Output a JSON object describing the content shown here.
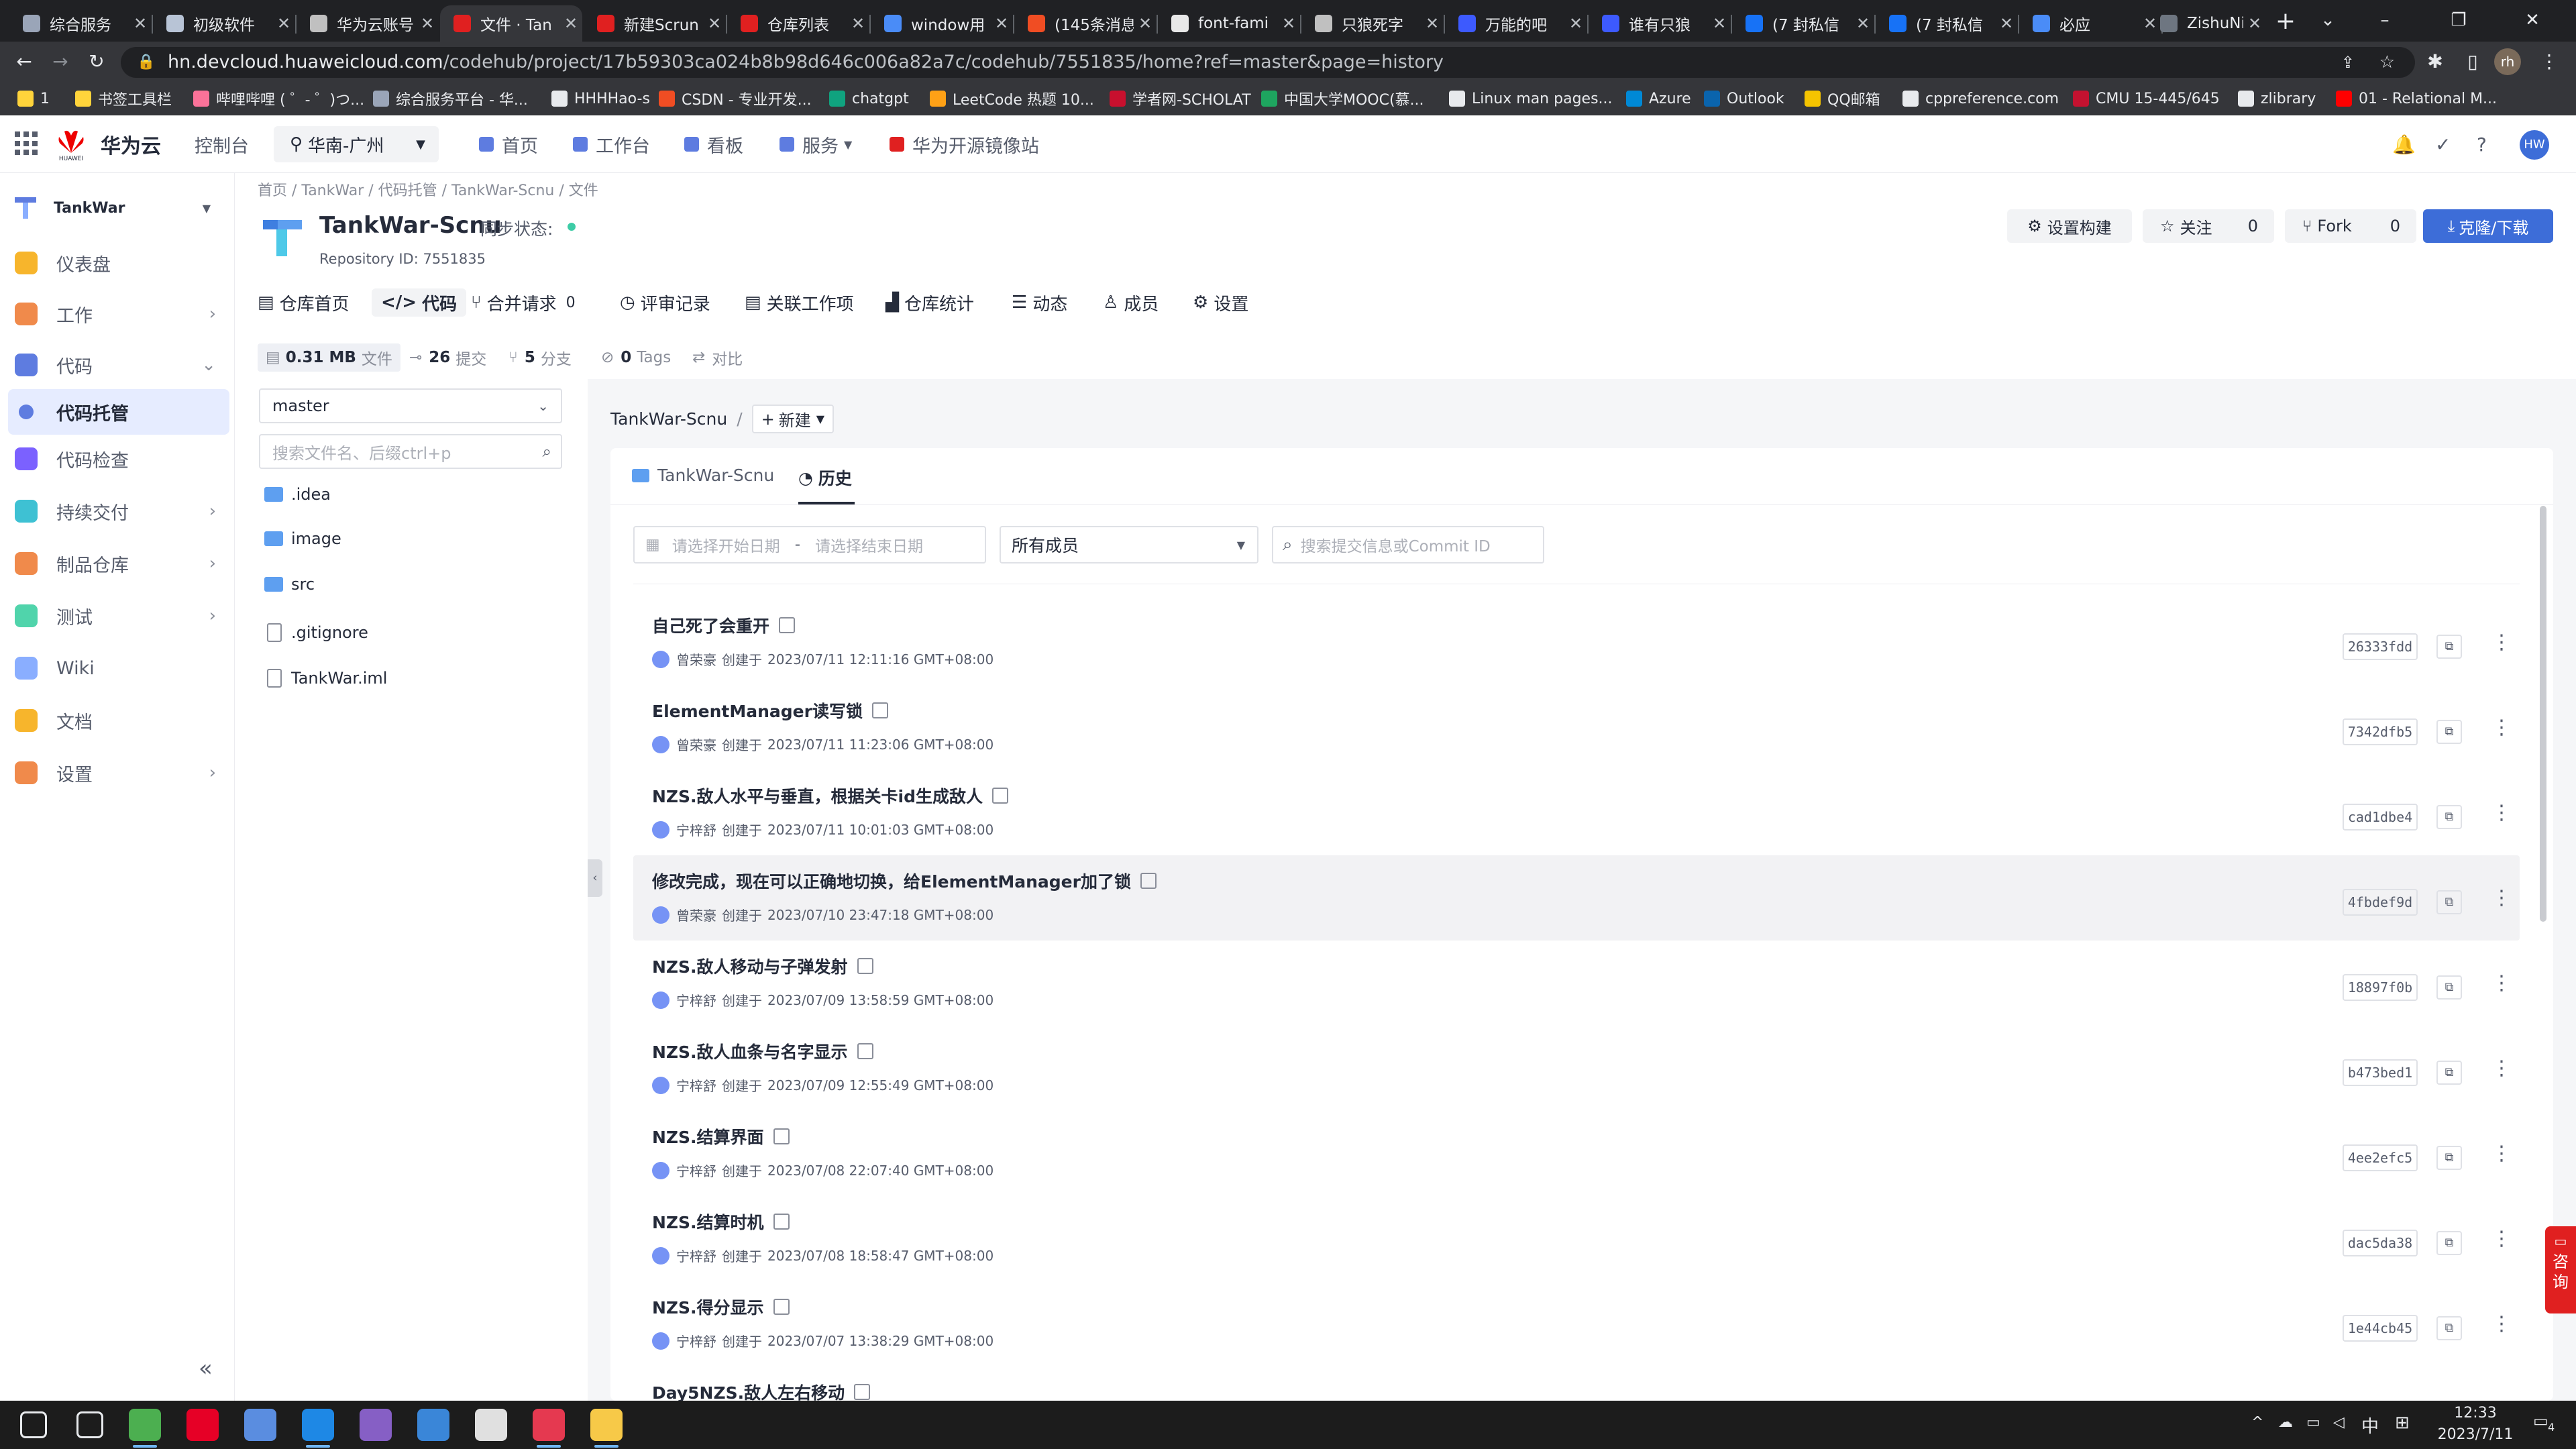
{
  "browser": {
    "tabs": [
      {
        "label": "综合服务",
        "color": "#9aa5b8",
        "active": false
      },
      {
        "label": "初级软件",
        "color": "#b8c4d6",
        "active": false
      },
      {
        "label": "华为云账号",
        "color": "#c0c0c0",
        "active": false
      },
      {
        "label": "文件 · Tan",
        "color": "#e02020",
        "active": true
      },
      {
        "label": "新建Scrun",
        "color": "#e02020",
        "active": false
      },
      {
        "label": "仓库列表",
        "color": "#e02020",
        "active": false
      },
      {
        "label": "window用",
        "color": "#4a8cf7",
        "active": false
      },
      {
        "label": "(145条消息",
        "color": "#f04d23",
        "active": false
      },
      {
        "label": "font-fami",
        "color": "#e8e8e8",
        "active": false
      },
      {
        "label": "只狼死字",
        "color": "#c0c0c0",
        "active": false
      },
      {
        "label": "万能的吧",
        "color": "#3d5afe",
        "active": false
      },
      {
        "label": "谁有只狼",
        "color": "#3d5afe",
        "active": false
      },
      {
        "label": "(7 封私信",
        "color": "#1772f6",
        "active": false
      },
      {
        "label": "(7 封私信",
        "color": "#1772f6",
        "active": false
      },
      {
        "label": "必应",
        "color": "#4a8cf7",
        "active": false
      },
      {
        "label": "ZishuNin",
        "color": "#6e7681",
        "active": false
      }
    ],
    "new_tab": "+",
    "url_host": "hn.devcloud.huaweicloud.com",
    "url_path": "/codehub/project/17b59303ca024b8b98d646c006a82a7c/codehub/7551835/home?ref=master&page=history",
    "profile_initials": "rh",
    "bookmarks": [
      {
        "label": "1",
        "color": "#ffd43b"
      },
      {
        "label": "书签工具栏",
        "color": "#ffd43b"
      },
      {
        "label": "哔哩哔哩 ( ゜- ゜)つ...",
        "color": "#fb7299"
      },
      {
        "label": "综合服务平台 - 华...",
        "color": "#9aa5b8"
      },
      {
        "label": "HHHHao-s",
        "color": "#e8eaed"
      },
      {
        "label": "CSDN - 专业开发...",
        "color": "#f04d23"
      },
      {
        "label": "chatgpt",
        "color": "#10a37f"
      },
      {
        "label": "LeetCode 热题 10...",
        "color": "#ffa116"
      },
      {
        "label": "学者网-SCHOLAT",
        "color": "#c8102e"
      },
      {
        "label": "中国大学MOOC(慕...",
        "color": "#1ea55f"
      },
      {
        "label": "Linux man pages...",
        "color": "#e8eaed"
      },
      {
        "label": "Azure",
        "color": "#0089d6"
      },
      {
        "label": "Outlook",
        "color": "#0a64ad"
      },
      {
        "label": "QQ邮箱",
        "color": "#f5c400"
      },
      {
        "label": "cppreference.com",
        "color": "#e8eaed"
      },
      {
        "label": "CMU 15-445/645",
        "color": "#c41230"
      },
      {
        "label": "zlibrary",
        "color": "#e8eaed"
      },
      {
        "label": "01 - Relational M...",
        "color": "#ff0000"
      }
    ]
  },
  "header": {
    "brand": "华为云",
    "huawei_text": "HUAWEI",
    "console": "控制台",
    "region": "华南-广州",
    "nav": [
      "首页",
      "工作台",
      "看板",
      "服务",
      "华为开源镜像站"
    ],
    "avatar": "HW"
  },
  "sidebar": {
    "project": "TankWar",
    "items": [
      {
        "label": "仪表盘",
        "color": "#f7b52c",
        "chevron": ""
      },
      {
        "label": "工作",
        "color": "#f08a4b",
        "chevron": "›"
      },
      {
        "label": "代码",
        "color": "#5e7ce0",
        "chevron": "⌄"
      },
      {
        "label": "代码托管",
        "color": "#5e7ce0",
        "chevron": ""
      },
      {
        "label": "代码检查",
        "color": "#7b61ff",
        "chevron": ""
      },
      {
        "label": "持续交付",
        "color": "#3ec1d3",
        "chevron": "›"
      },
      {
        "label": "制品仓库",
        "color": "#f08a4b",
        "chevron": "›"
      },
      {
        "label": "测试",
        "color": "#50d4ab",
        "chevron": "›"
      },
      {
        "label": "Wiki",
        "color": "#8aaeff",
        "chevron": ""
      },
      {
        "label": "文档",
        "color": "#f7b52c",
        "chevron": ""
      },
      {
        "label": "设置",
        "color": "#f08a4b",
        "chevron": "›"
      }
    ],
    "collapse": "«"
  },
  "repo": {
    "breadcrumb": "首页  /  TankWar  /  代码托管  /  TankWar-Scnu  /  文件",
    "name": "TankWar-Scnu",
    "sync_label": "同步状态:",
    "repo_id": "Repository ID: 7551835",
    "buttons": {
      "build": "设置构建",
      "follow": "关注",
      "follow_count": "0",
      "fork": "Fork",
      "fork_count": "0",
      "clone": "克隆/下载"
    },
    "tabs": [
      "仓库首页",
      "代码",
      "合并请求",
      "评审记录",
      "关联工作项",
      "仓库统计",
      "动态",
      "成员",
      "设置"
    ],
    "merge_count": "0",
    "stats": {
      "size": "0.31 MB",
      "size_label": "文件",
      "commits": "26",
      "commits_label": "提交",
      "branches": "5",
      "branches_label": "分支",
      "tags": "0",
      "tags_label": "Tags",
      "compare": "对比"
    }
  },
  "files": {
    "branch": "master",
    "search_placeholder": "搜索文件名、后缀ctrl+p",
    "items": [
      {
        "name": ".idea",
        "type": "folder"
      },
      {
        "name": "image",
        "type": "folder"
      },
      {
        "name": "src",
        "type": "folder"
      },
      {
        "name": ".gitignore",
        "type": "file"
      },
      {
        "name": "TankWar.iml",
        "type": "file"
      }
    ]
  },
  "history": {
    "path_root": "TankWar-Scnu",
    "new_btn": "新建",
    "tabs": [
      "TankWar-Scnu",
      "历史"
    ],
    "start_placeholder": "请选择开始日期",
    "date_sep": "-",
    "end_placeholder": "请选择结束日期",
    "member_select": "所有成员",
    "search_placeholder": "搜索提交信息或Commit ID",
    "commits": [
      {
        "title": "自己死了会重开",
        "author": "曾荣豪",
        "created_label": "创建于",
        "time": "2023/07/11 12:11:16 GMT+08:00",
        "hash": "26333fdd"
      },
      {
        "title": "ElementManager读写锁",
        "author": "曾荣豪",
        "created_label": "创建于",
        "time": "2023/07/11 11:23:06 GMT+08:00",
        "hash": "7342dfb5"
      },
      {
        "title": "NZS.敌人水平与垂直，根据关卡id生成敌人",
        "author": "宁梓舒",
        "created_label": "创建于",
        "time": "2023/07/11 10:01:03 GMT+08:00",
        "hash": "cad1dbe4"
      },
      {
        "title": "修改完成，现在可以正确地切换，给ElementManager加了锁",
        "author": "曾荣豪",
        "created_label": "创建于",
        "time": "2023/07/10 23:47:18 GMT+08:00",
        "hash": "4fbdef9d"
      },
      {
        "title": "NZS.敌人移动与子弹发射",
        "author": "宁梓舒",
        "created_label": "创建于",
        "time": "2023/07/09 13:58:59 GMT+08:00",
        "hash": "18897f0b"
      },
      {
        "title": "NZS.敌人血条与名字显示",
        "author": "宁梓舒",
        "created_label": "创建于",
        "time": "2023/07/09 12:55:49 GMT+08:00",
        "hash": "b473bed1"
      },
      {
        "title": "NZS.结算界面",
        "author": "宁梓舒",
        "created_label": "创建于",
        "time": "2023/07/08 22:07:40 GMT+08:00",
        "hash": "4ee2efc5"
      },
      {
        "title": "NZS.结算时机",
        "author": "宁梓舒",
        "created_label": "创建于",
        "time": "2023/07/08 18:58:47 GMT+08:00",
        "hash": "dac5da38"
      },
      {
        "title": "NZS.得分显示",
        "author": "宁梓舒",
        "created_label": "创建于",
        "time": "2023/07/07 13:38:29 GMT+08:00",
        "hash": "1e44cb45"
      },
      {
        "title": "Day5NZS.敌人左右移动",
        "author": "",
        "created_label": "",
        "time": "",
        "hash": ""
      }
    ]
  },
  "consult": "咨询",
  "taskbar": {
    "icons": [
      {
        "name": "start-icon",
        "color": "#e8eaed"
      },
      {
        "name": "search-icon",
        "color": "#e8eaed"
      },
      {
        "name": "chrome-icon",
        "color": "#4caf50"
      },
      {
        "name": "netease-music-icon",
        "color": "#e60026"
      },
      {
        "name": "feather-icon",
        "color": "#5a8de0"
      },
      {
        "name": "vscode-icon",
        "color": "#1e88e5"
      },
      {
        "name": "visual-studio-icon",
        "color": "#865fc5"
      },
      {
        "name": "store-icon",
        "color": "#3a86d8"
      },
      {
        "name": "gradle-icon",
        "color": "#e0e0e0"
      },
      {
        "name": "intellij-icon",
        "color": "#e53950"
      },
      {
        "name": "file-explorer-icon",
        "color": "#f7c948"
      }
    ],
    "ime": "中",
    "time": "12:33",
    "date": "2023/7/11",
    "notif": "4"
  }
}
